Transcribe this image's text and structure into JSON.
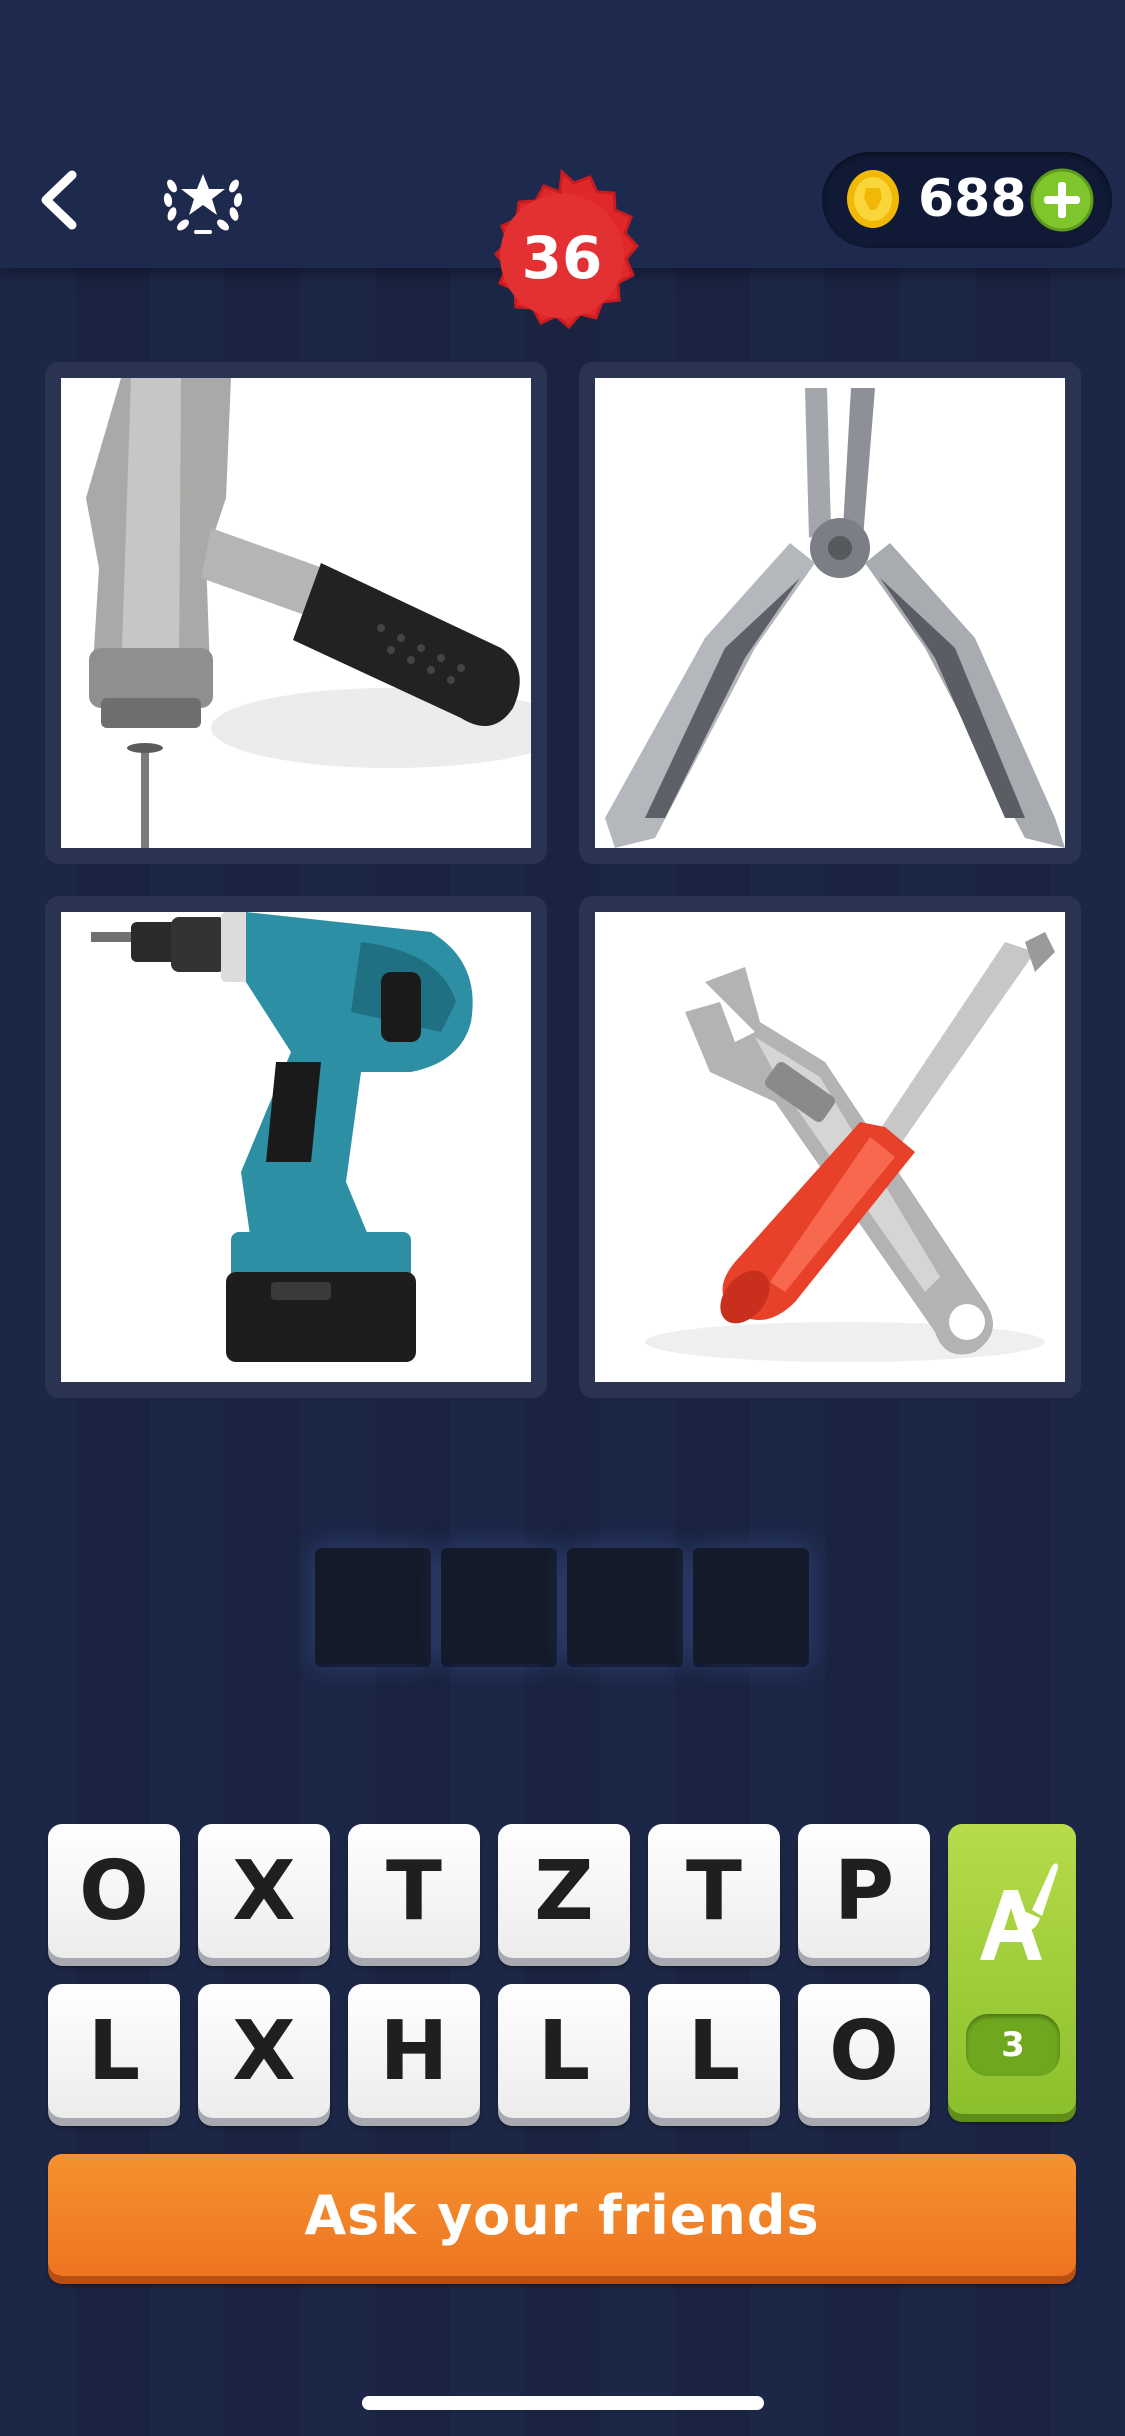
{
  "header": {
    "back_icon": "chevron-left-icon",
    "achievements_icon": "laurel-star-icon",
    "coins": "688",
    "coin_icon": "coin-icon",
    "add_coins_icon": "plus-icon",
    "level": "36"
  },
  "puzzle": {
    "images": [
      {
        "subject": "hammer",
        "icon": "hammer-picture"
      },
      {
        "subject": "pliers",
        "icon": "pliers-picture"
      },
      {
        "subject": "drill",
        "icon": "drill-picture"
      },
      {
        "subject": "wrench and screwdriver",
        "icon": "wrench-screwdriver-picture"
      }
    ],
    "answer_slots": [
      "",
      "",
      "",
      ""
    ]
  },
  "keyboard": {
    "row1": [
      "O",
      "X",
      "T",
      "Z",
      "T",
      "P"
    ],
    "row2": [
      "L",
      "X",
      "H",
      "L",
      "L",
      "O"
    ]
  },
  "hint": {
    "icon": "letter-brush-icon",
    "count": "3"
  },
  "ask_button": {
    "label": "Ask your friends"
  },
  "colors": {
    "background": "#1c2747",
    "level_badge": "#e0282a",
    "hint_green": "#a6cf3a",
    "ask_orange": "#f28328",
    "coin_gold": "#f5c518"
  }
}
